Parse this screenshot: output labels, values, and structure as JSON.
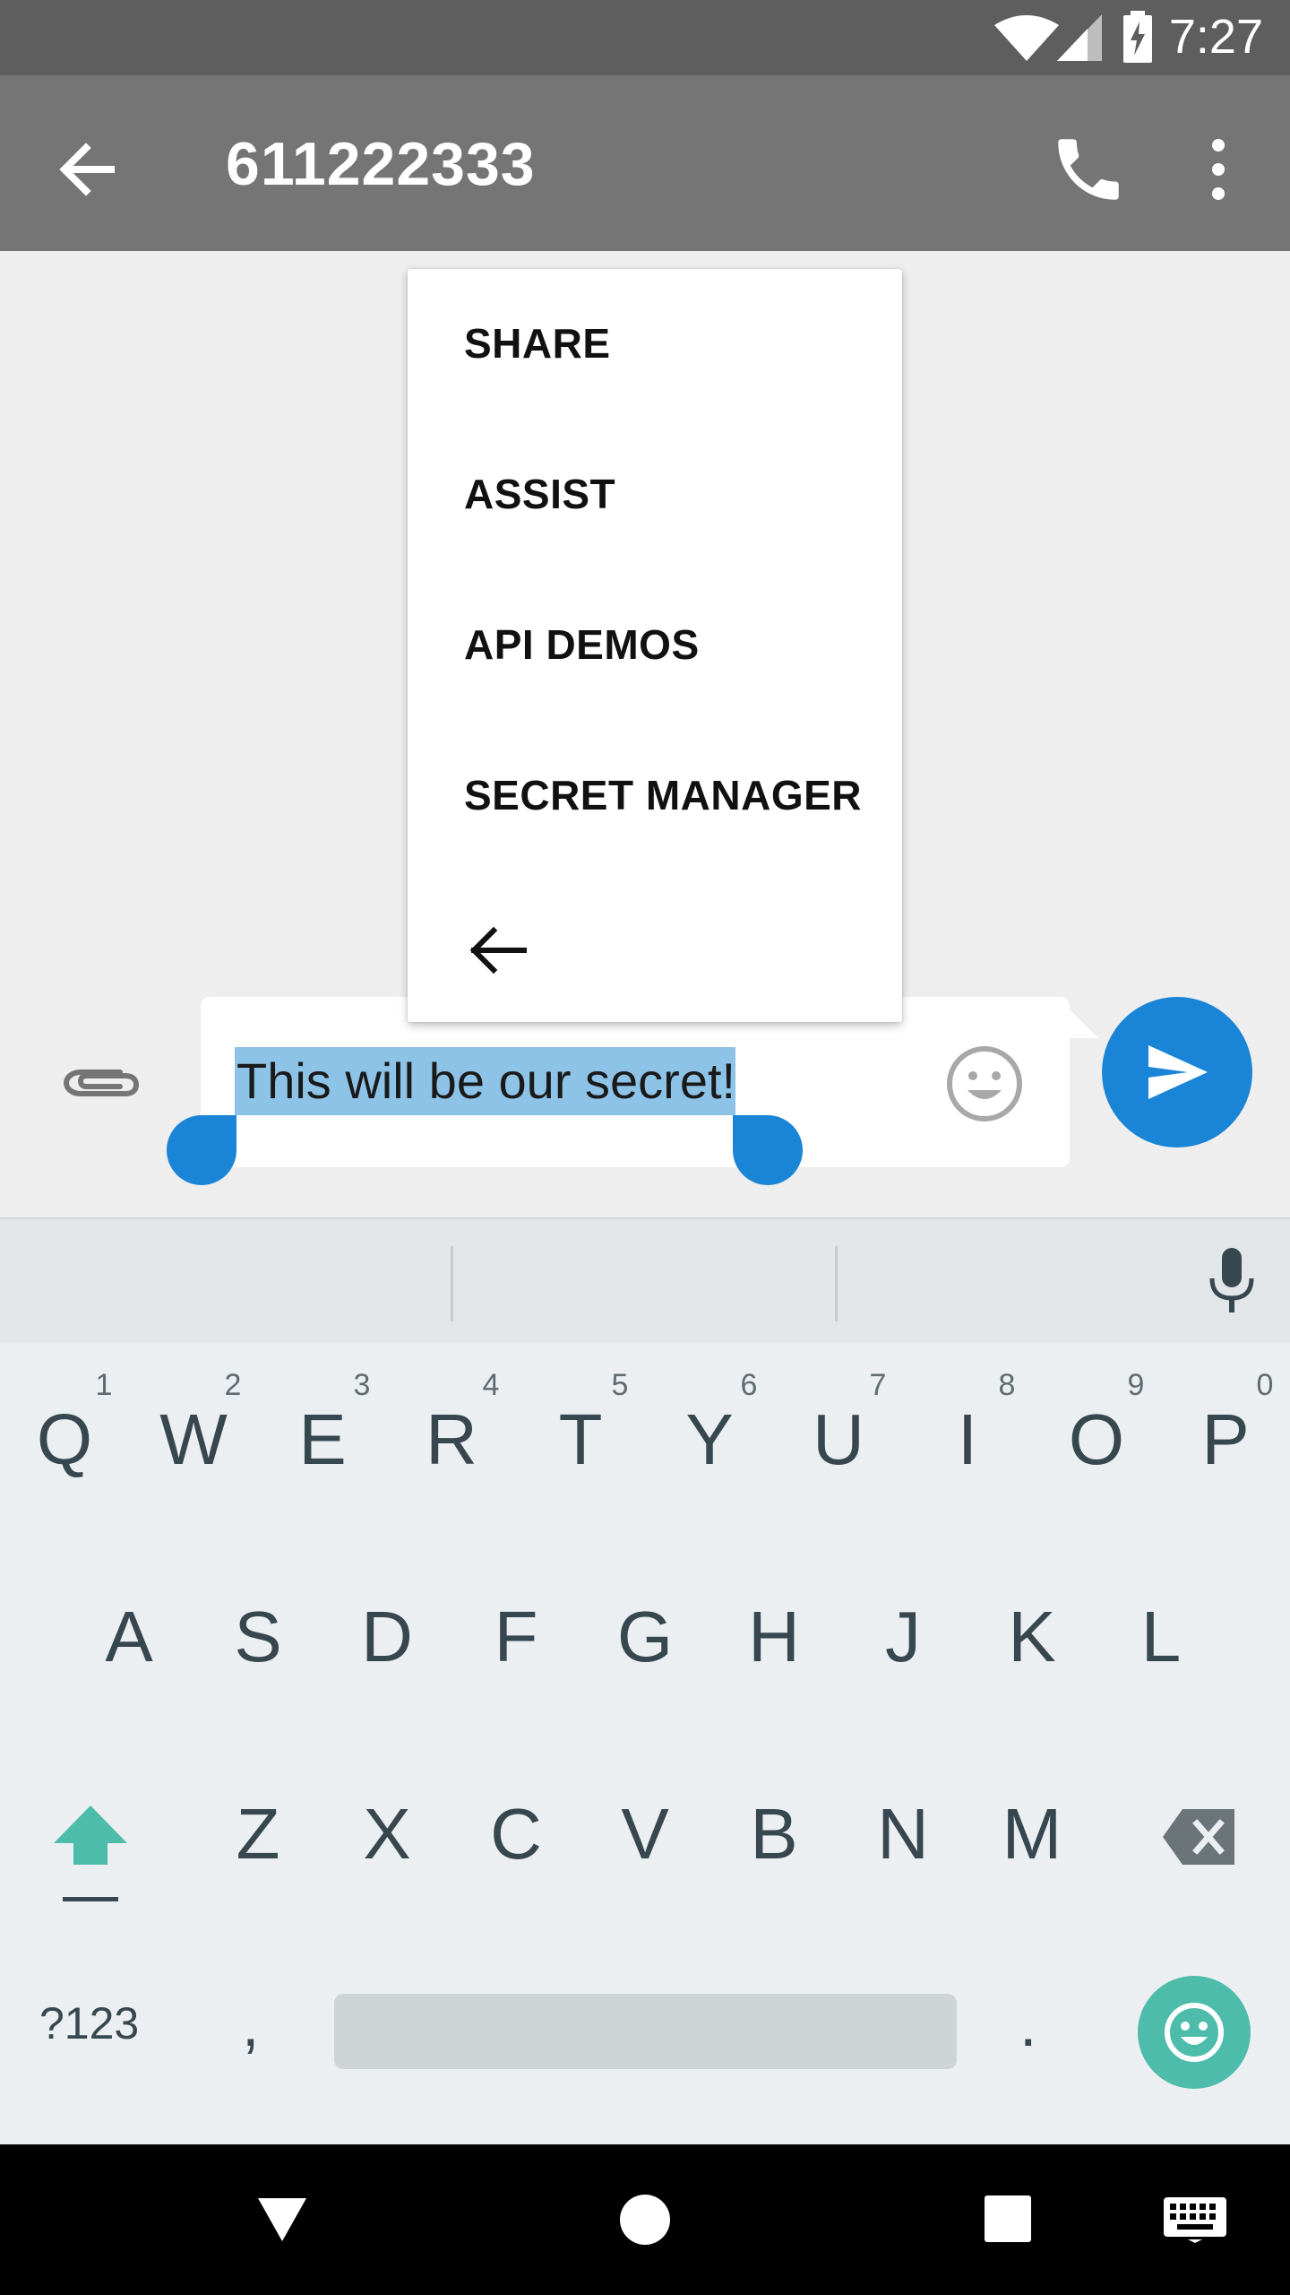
{
  "status_bar": {
    "time": "7:27",
    "icons": [
      "wifi-icon",
      "signal-icon",
      "battery-charging-icon"
    ]
  },
  "toolbar": {
    "title": "611222333",
    "icons": [
      "back-arrow-icon",
      "phone-icon",
      "more-vert-icon"
    ]
  },
  "context_menu": {
    "items": [
      "SHARE",
      "ASSIST",
      "API DEMOS",
      "SECRET MANAGER"
    ],
    "back_icon": "back-arrow-icon"
  },
  "compose": {
    "text": "This will be our secret!",
    "selection": "all",
    "icons": [
      "attach-icon",
      "emoji-icon",
      "send-icon"
    ],
    "colors": {
      "selection": "#8ec3e8",
      "accent": "#1a85d6"
    }
  },
  "keyboard": {
    "row1": [
      "Q",
      "W",
      "E",
      "R",
      "T",
      "Y",
      "U",
      "I",
      "O",
      "P"
    ],
    "row1_hints": [
      "1",
      "2",
      "3",
      "4",
      "5",
      "6",
      "7",
      "8",
      "9",
      "0"
    ],
    "row2": [
      "A",
      "S",
      "D",
      "F",
      "G",
      "H",
      "J",
      "K",
      "L"
    ],
    "row3": [
      "Z",
      "X",
      "C",
      "V",
      "B",
      "N",
      "M"
    ],
    "symbols_label": "?123",
    "comma": ",",
    "period": ".",
    "icons": [
      "mic-icon",
      "shift-icon",
      "backspace-icon",
      "emoji-icon"
    ],
    "colors": {
      "emoji_key": "#4dbcaa"
    }
  },
  "nav_bar": {
    "icons": [
      "nav-back-icon",
      "nav-home-icon",
      "nav-recents-icon",
      "keyboard-icon"
    ]
  }
}
